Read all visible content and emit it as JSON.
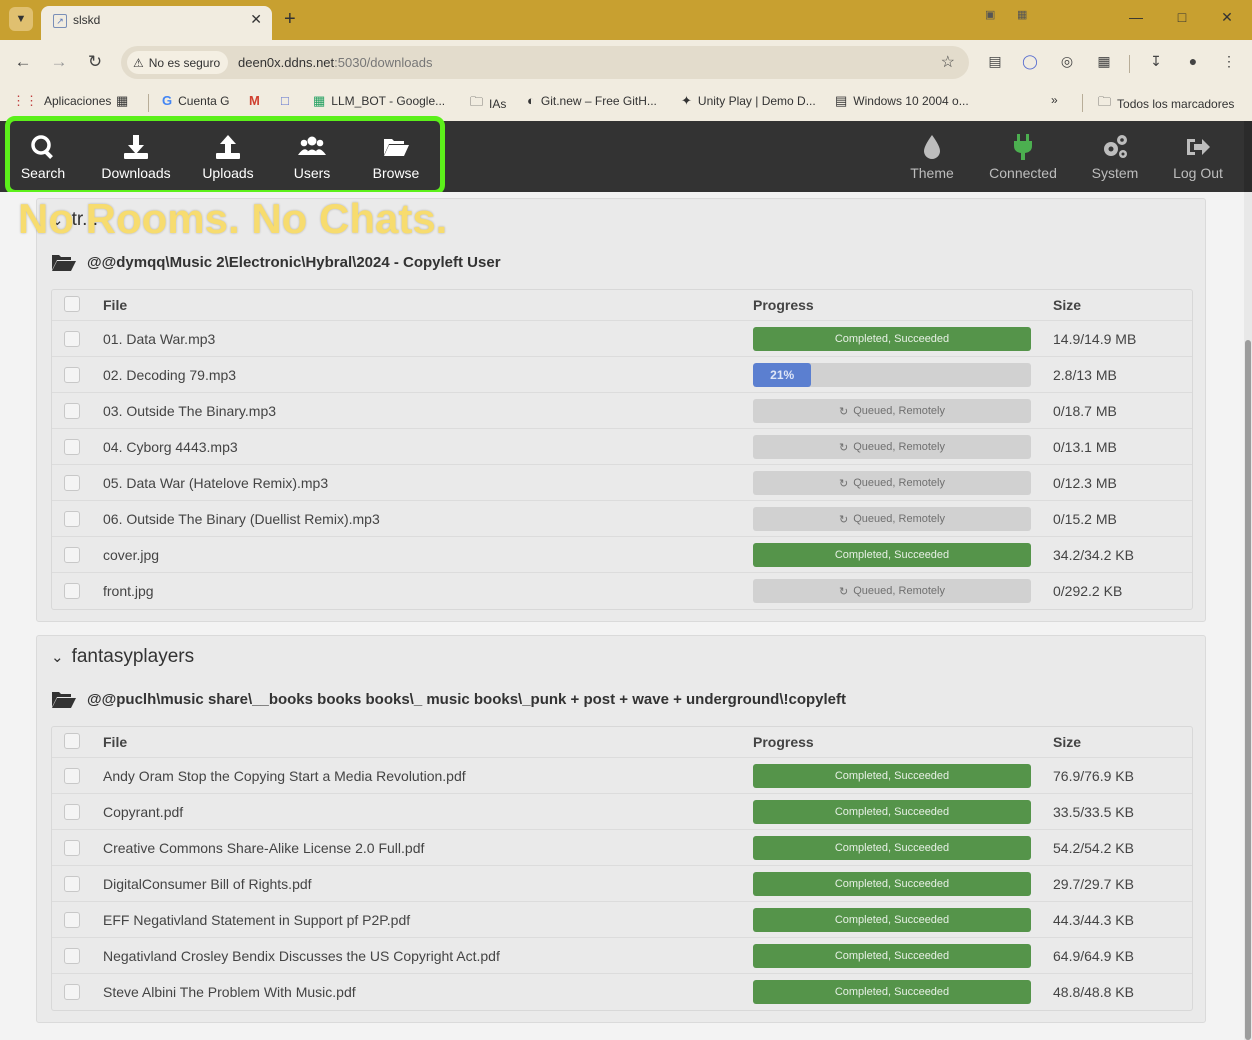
{
  "browser": {
    "tab_title": "slskd",
    "security_label": "No es seguro",
    "url_host": "deen0x.ddns.net",
    "url_path": ":5030/downloads",
    "bookmarks": [
      {
        "label": "Aplicaciones",
        "icon": "apps-grid-icon"
      },
      {
        "label": "Cuenta G",
        "icon": "google-icon"
      },
      {
        "label": "LLM_BOT - Google...",
        "icon": "sheets-icon"
      },
      {
        "label": "IAs",
        "icon": "folder-icon"
      },
      {
        "label": "Git.new – Free GitH...",
        "icon": "gitnew-icon"
      },
      {
        "label": "Unity Play | Demo D...",
        "icon": "unity-icon"
      },
      {
        "label": "Windows 10 2004 o...",
        "icon": "windows-icon"
      }
    ],
    "all_bookmarks_label": "Todos los marcadores"
  },
  "nav": {
    "left": [
      {
        "label": "Search",
        "icon": "search-icon"
      },
      {
        "label": "Downloads",
        "icon": "download-icon"
      },
      {
        "label": "Uploads",
        "icon": "upload-icon"
      },
      {
        "label": "Users",
        "icon": "users-icon"
      },
      {
        "label": "Browse",
        "icon": "folder-open-icon"
      }
    ],
    "right": [
      {
        "label": "Theme",
        "icon": "theme-drop-icon"
      },
      {
        "label": "Connected",
        "icon": "plug-icon"
      },
      {
        "label": "System",
        "icon": "cogs-icon"
      },
      {
        "label": "Log Out",
        "icon": "logout-icon"
      }
    ]
  },
  "annotation": {
    "text": "No Rooms. No Chats.",
    "color": "#f7dc6f",
    "highlight_color": "#5cf01a"
  },
  "table_headers": {
    "file": "File",
    "progress": "Progress",
    "size": "Size"
  },
  "groups": [
    {
      "user": "tr...",
      "directory": "@@dymqq\\Music 2\\Electronic\\Hybral\\2024 - Copyleft User",
      "files": [
        {
          "name": "01. Data War.mp3",
          "status": "Completed, Succeeded",
          "state": "done",
          "size": "14.9/14.9 MB"
        },
        {
          "name": "02. Decoding 79.mp3",
          "status": "21%",
          "state": "progress",
          "percent": 21,
          "size": "2.8/13 MB"
        },
        {
          "name": "03. Outside The Binary.mp3",
          "status": "Queued, Remotely",
          "state": "queued",
          "size": "0/18.7 MB"
        },
        {
          "name": "04. Cyborg 4443.mp3",
          "status": "Queued, Remotely",
          "state": "queued",
          "size": "0/13.1 MB"
        },
        {
          "name": "05. Data War (Hatelove Remix).mp3",
          "status": "Queued, Remotely",
          "state": "queued",
          "size": "0/12.3 MB"
        },
        {
          "name": "06. Outside The Binary (Duellist Remix).mp3",
          "status": "Queued, Remotely",
          "state": "queued",
          "size": "0/15.2 MB"
        },
        {
          "name": "cover.jpg",
          "status": "Completed, Succeeded",
          "state": "done",
          "size": "34.2/34.2 KB"
        },
        {
          "name": "front.jpg",
          "status": "Queued, Remotely",
          "state": "queued",
          "size": "0/292.2 KB"
        }
      ]
    },
    {
      "user": "fantasyplayers",
      "directory": "@@puclh\\music share\\__books books books\\_ music books\\_punk + post + wave + underground\\!copyleft",
      "files": [
        {
          "name": "Andy Oram Stop the Copying Start a Media Revolution.pdf",
          "status": "Completed, Succeeded",
          "state": "done",
          "size": "76.9/76.9 KB"
        },
        {
          "name": "Copyrant.pdf",
          "status": "Completed, Succeeded",
          "state": "done",
          "size": "33.5/33.5 KB"
        },
        {
          "name": "Creative Commons Share-Alike License 2.0 Full.pdf",
          "status": "Completed, Succeeded",
          "state": "done",
          "size": "54.2/54.2 KB"
        },
        {
          "name": "DigitalConsumer Bill of Rights.pdf",
          "status": "Completed, Succeeded",
          "state": "done",
          "size": "29.7/29.7 KB"
        },
        {
          "name": "EFF Negativland Statement in Support pf P2P.pdf",
          "status": "Completed, Succeeded",
          "state": "done",
          "size": "44.3/44.3 KB"
        },
        {
          "name": "Negativland Crosley Bendix Discusses the US Copyright Act.pdf",
          "status": "Completed, Succeeded",
          "state": "done",
          "size": "64.9/64.9 KB"
        },
        {
          "name": "Steve Albini The Problem With Music.pdf",
          "status": "Completed, Succeeded",
          "state": "done",
          "size": "48.8/48.8 KB"
        }
      ]
    }
  ]
}
